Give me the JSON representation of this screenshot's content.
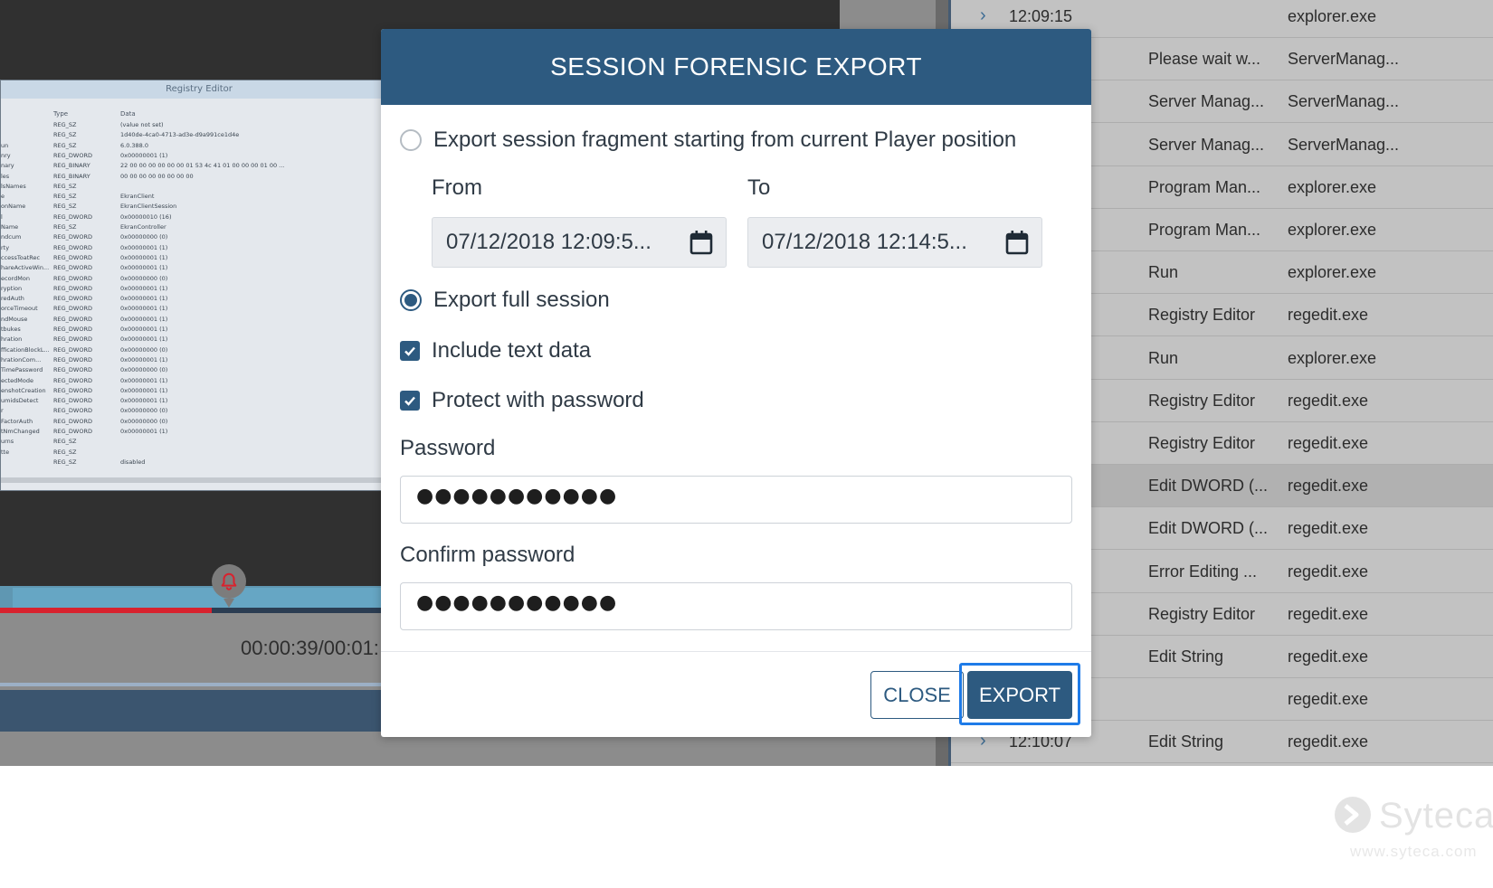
{
  "player": {
    "embedded_window_title": "Registry Editor",
    "reg_columns": [
      "Type",
      "Data"
    ],
    "reg_rows": [
      {
        "name": "",
        "type": "REG_SZ",
        "data": "(value not set)"
      },
      {
        "name": "",
        "type": "REG_SZ",
        "data": "1d40de-4ca0-4713-ad3e-d9a991ce1d4e"
      },
      {
        "name": "un",
        "type": "REG_SZ",
        "data": "6.0.388.0"
      },
      {
        "name": "nry",
        "type": "REG_DWORD",
        "data": "0x00000001 (1)"
      },
      {
        "name": "nary",
        "type": "REG_BINARY",
        "data": "22 00 00 00 00 00 00 01 53 4c 41 01 00 00 00 01 00 ..."
      },
      {
        "name": "les",
        "type": "REG_BINARY",
        "data": "00 00 00 00 00 00 00 00"
      },
      {
        "name": "lsNames",
        "type": "REG_SZ",
        "data": ""
      },
      {
        "name": "e",
        "type": "REG_SZ",
        "data": "EkranClient"
      },
      {
        "name": "onName",
        "type": "REG_SZ",
        "data": "EkranClientSession"
      },
      {
        "name": "l",
        "type": "REG_DWORD",
        "data": "0x00000010 (16)"
      },
      {
        "name": "Name",
        "type": "REG_SZ",
        "data": "EkranController"
      },
      {
        "name": "ndcum",
        "type": "REG_DWORD",
        "data": "0x00000000 (0)"
      },
      {
        "name": "rty",
        "type": "REG_DWORD",
        "data": "0x00000001 (1)"
      },
      {
        "name": "ccessToatRec",
        "type": "REG_DWORD",
        "data": "0x00000001 (1)"
      },
      {
        "name": "hareActiveWin...",
        "type": "REG_DWORD",
        "data": "0x00000001 (1)"
      },
      {
        "name": "ecordMon",
        "type": "REG_DWORD",
        "data": "0x00000000 (0)"
      },
      {
        "name": "ryption",
        "type": "REG_DWORD",
        "data": "0x00000001 (1)"
      },
      {
        "name": "redAuth",
        "type": "REG_DWORD",
        "data": "0x00000001 (1)"
      },
      {
        "name": "orceTimeout",
        "type": "REG_DWORD",
        "data": "0x00000001 (1)"
      },
      {
        "name": "ndMouse",
        "type": "REG_DWORD",
        "data": "0x00000001 (1)"
      },
      {
        "name": "tbukes",
        "type": "REG_DWORD",
        "data": "0x00000001 (1)"
      },
      {
        "name": "hration",
        "type": "REG_DWORD",
        "data": "0x00000001 (1)"
      },
      {
        "name": "fficationBlockL...",
        "type": "REG_DWORD",
        "data": "0x00000000 (0)"
      },
      {
        "name": "hrationCom...",
        "type": "REG_DWORD",
        "data": "0x00000001 (1)"
      },
      {
        "name": "TimePassword",
        "type": "REG_DWORD",
        "data": "0x00000000 (0)"
      },
      {
        "name": "ectedMode",
        "type": "REG_DWORD",
        "data": "0x00000001 (1)"
      },
      {
        "name": "enshotCreation",
        "type": "REG_DWORD",
        "data": "0x00000001 (1)"
      },
      {
        "name": "umidsDetect",
        "type": "REG_DWORD",
        "data": "0x00000001 (1)"
      },
      {
        "name": "r",
        "type": "REG_DWORD",
        "data": "0x00000000 (0)"
      },
      {
        "name": "FactorAuth",
        "type": "REG_DWORD",
        "data": "0x00000000 (0)"
      },
      {
        "name": "tNmChanged",
        "type": "REG_DWORD",
        "data": "0x00000001 (1)"
      },
      {
        "name": "urns",
        "type": "REG_SZ",
        "data": ""
      },
      {
        "name": "tte",
        "type": "REG_SZ",
        "data": ""
      },
      {
        "name": "",
        "type": "REG_SZ",
        "data": "disabled"
      }
    ],
    "time_readout": "00:00:39/00:01:",
    "bell_icon": "bell-icon"
  },
  "activity_list": {
    "rows": [
      {
        "time": "12:09:15",
        "title": "",
        "process": "explorer.exe",
        "expandable": true
      },
      {
        "time": "",
        "title": "Please wait w...",
        "process": "ServerManag..."
      },
      {
        "time": "",
        "title": "Server Manag...",
        "process": "ServerManag..."
      },
      {
        "time": "",
        "title": "Server Manag...",
        "process": "ServerManag..."
      },
      {
        "time": "",
        "title": "Program Man...",
        "process": "explorer.exe"
      },
      {
        "time": "",
        "title": "Program Man...",
        "process": "explorer.exe"
      },
      {
        "time": "",
        "title": "Run",
        "process": "explorer.exe"
      },
      {
        "time": "",
        "title": "Registry Editor",
        "process": "regedit.exe"
      },
      {
        "time": "",
        "title": "Run",
        "process": "explorer.exe"
      },
      {
        "time": "",
        "title": "Registry Editor",
        "process": "regedit.exe"
      },
      {
        "time": "",
        "title": "Registry Editor",
        "process": "regedit.exe"
      },
      {
        "time": "",
        "title": "Edit DWORD (...",
        "process": "regedit.exe",
        "selected": true
      },
      {
        "time": "",
        "title": "Edit DWORD (...",
        "process": "regedit.exe"
      },
      {
        "time": "",
        "title": "Error Editing ...",
        "process": "regedit.exe"
      },
      {
        "time": "",
        "title": "Registry Editor",
        "process": "regedit.exe"
      },
      {
        "time": "",
        "title": "Edit String",
        "process": "regedit.exe"
      },
      {
        "time": "",
        "title": "",
        "process": "regedit.exe"
      },
      {
        "time": "12:10:07",
        "title": "Edit String",
        "process": "regedit.exe",
        "expandable": true
      }
    ]
  },
  "modal": {
    "title": "SESSION FORENSIC EXPORT",
    "option_fragment_label": "Export session fragment starting from current Player position",
    "option_fragment_selected": false,
    "from_label": "From",
    "to_label": "To",
    "from_value": "07/12/2018 12:09:5...",
    "to_value": "07/12/2018 12:14:5...",
    "calendar_icon": "calendar-icon",
    "option_full_label": "Export full session",
    "option_full_selected": true,
    "include_text_label": "Include text data",
    "include_text_checked": true,
    "protect_password_label": "Protect with password",
    "protect_password_checked": true,
    "password_label": "Password",
    "password_value": "●●●●●●●●●●●",
    "confirm_password_label": "Confirm password",
    "confirm_password_value": "●●●●●●●●●●●",
    "close_label": "CLOSE",
    "export_label": "EXPORT"
  },
  "brand": {
    "name": "Syteca",
    "url": "www.syteca.com"
  },
  "colors": {
    "header_blue": "#2d5a80",
    "focus_ring": "#1e7be8",
    "timeline_red": "#d8222e"
  }
}
